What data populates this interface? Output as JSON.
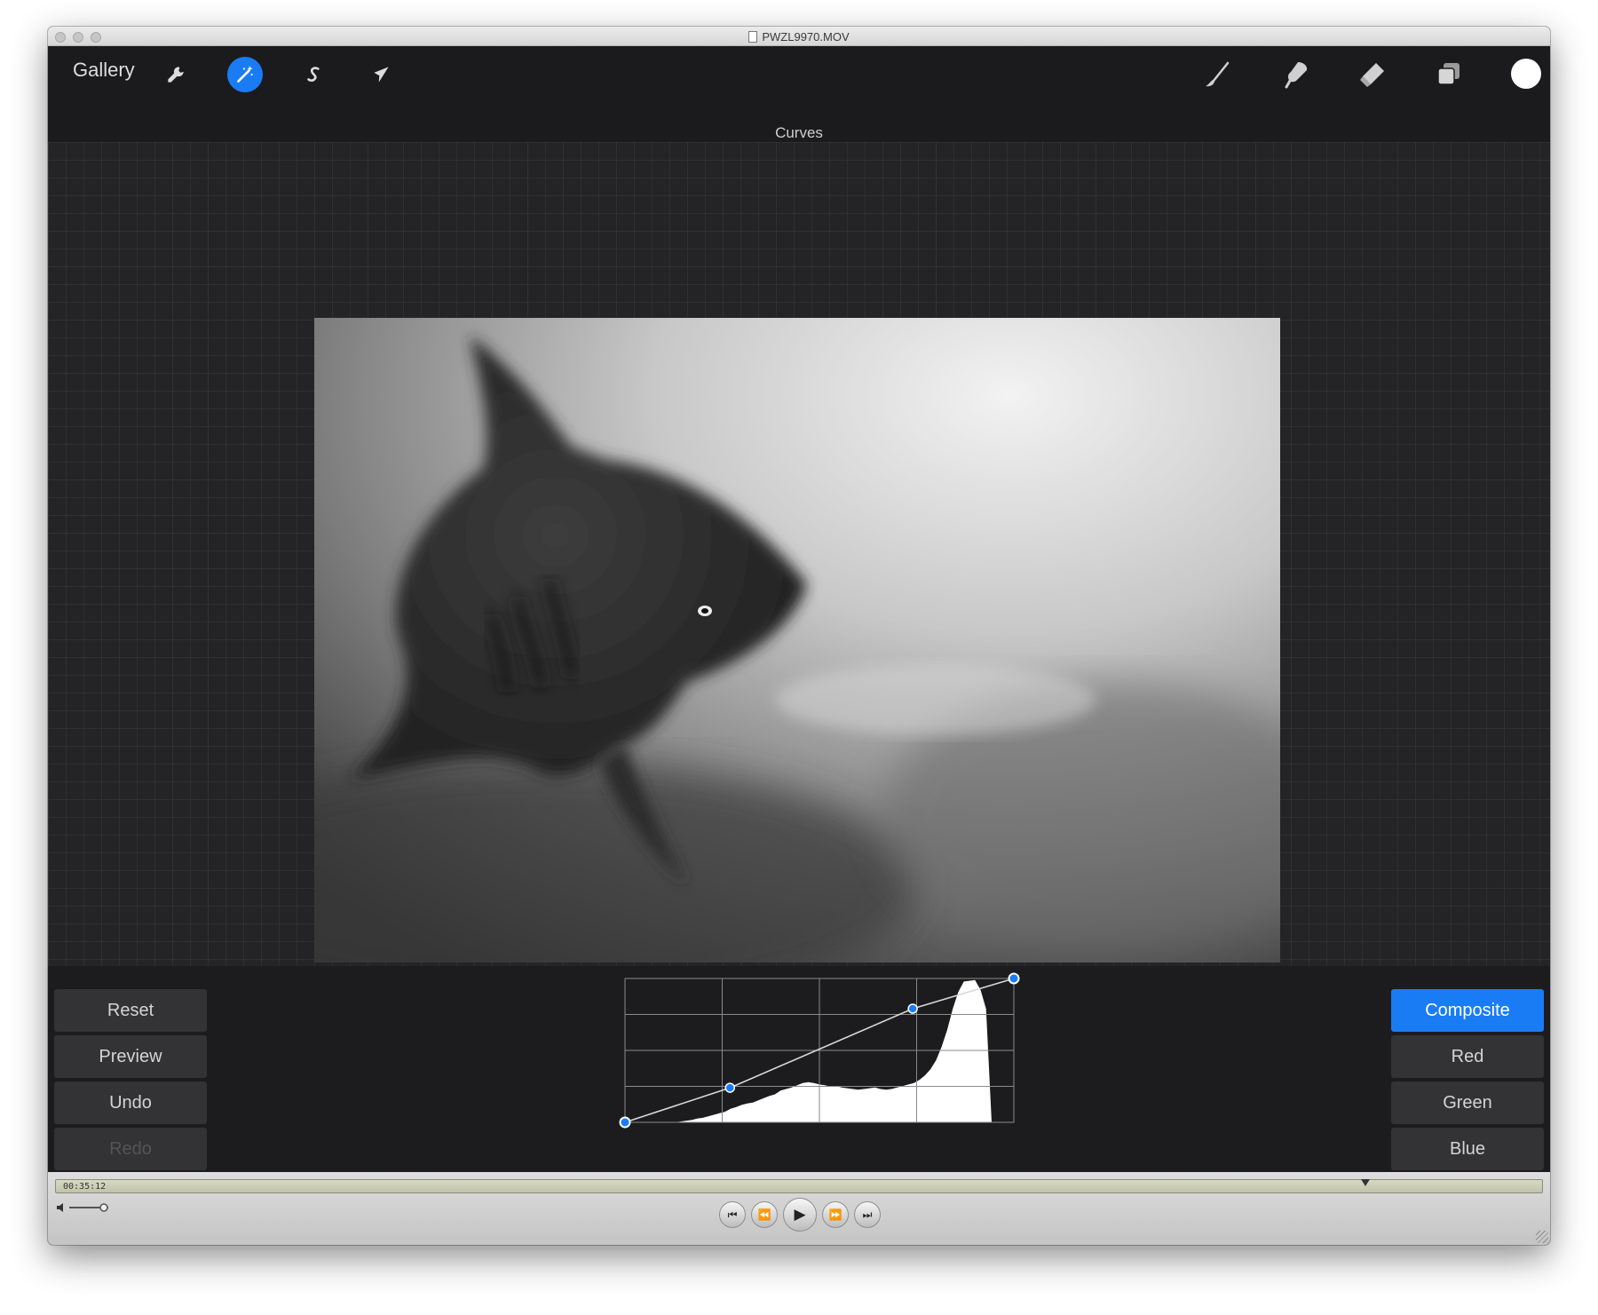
{
  "window": {
    "title": "PWZL9970.MOV"
  },
  "toolbar": {
    "gallery_label": "Gallery",
    "left_tools": [
      {
        "name": "actions",
        "icon": "wrench-icon"
      },
      {
        "name": "adjustments",
        "icon": "magic-wand-icon",
        "active": true
      },
      {
        "name": "selection",
        "icon": "selection-s-icon"
      },
      {
        "name": "transform",
        "icon": "arrow-cursor-icon"
      }
    ],
    "right_tools": [
      {
        "name": "brush",
        "icon": "brush-icon"
      },
      {
        "name": "smudge",
        "icon": "smudge-icon"
      },
      {
        "name": "eraser",
        "icon": "eraser-icon"
      },
      {
        "name": "layers",
        "icon": "layers-icon"
      }
    ],
    "current_color": "#ffffff",
    "active_tool_color": "#1a7cf5"
  },
  "panel_label": "Curves",
  "canvas": {
    "artwork": "grayscale painting of a shark in cloudy water"
  },
  "adjust_panel": {
    "left_buttons": [
      {
        "label": "Reset",
        "enabled": true
      },
      {
        "label": "Preview",
        "enabled": true
      },
      {
        "label": "Undo",
        "enabled": true
      },
      {
        "label": "Redo",
        "enabled": false
      }
    ],
    "channels": [
      {
        "label": "Composite",
        "selected": true
      },
      {
        "label": "Red",
        "selected": false
      },
      {
        "label": "Green",
        "selected": false
      },
      {
        "label": "Blue",
        "selected": false
      }
    ],
    "curve_points": [
      [
        0.0,
        0.0
      ],
      [
        0.27,
        0.24
      ],
      [
        0.74,
        0.79
      ],
      [
        1.0,
        1.0
      ]
    ],
    "histogram": [
      0,
      0,
      0,
      0,
      0,
      0,
      0,
      0,
      0,
      0,
      1,
      2,
      3,
      5,
      6,
      8,
      10,
      12,
      14,
      18,
      20,
      23,
      25,
      26,
      29,
      32,
      35,
      37,
      42,
      44,
      46,
      49,
      52,
      53,
      52,
      50,
      49,
      47,
      48,
      46,
      45,
      44,
      43,
      44,
      45,
      46,
      44,
      43,
      44,
      46,
      48,
      50,
      52,
      56,
      62,
      70,
      82,
      100,
      122,
      150,
      172,
      186,
      187,
      188,
      175,
      150,
      0,
      0,
      0,
      0,
      0
    ],
    "accent_color": "#1a7cf5"
  },
  "player": {
    "timecode": "00:35:12",
    "playhead_fraction": 0.87,
    "controls": [
      {
        "name": "skip-back",
        "glyph": "⏮"
      },
      {
        "name": "rewind",
        "glyph": "⏪"
      },
      {
        "name": "play",
        "glyph": "▶"
      },
      {
        "name": "fast-forward",
        "glyph": "⏩"
      },
      {
        "name": "skip-forward",
        "glyph": "⏭"
      }
    ]
  }
}
